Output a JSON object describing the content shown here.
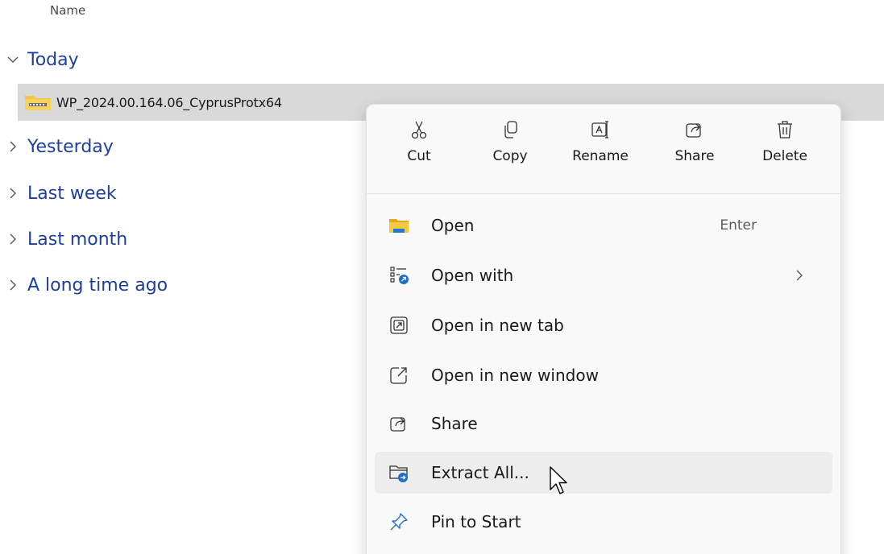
{
  "column_header": "Name",
  "groups": {
    "today": "Today",
    "yesterday": "Yesterday",
    "last_week": "Last week",
    "last_month": "Last month",
    "long_ago": "A long time ago"
  },
  "file": {
    "name": "WP_2024.00.164.06_CyprusProtx64",
    "icon": "zip-folder-icon"
  },
  "context_menu": {
    "quick_actions": {
      "cut": "Cut",
      "copy": "Copy",
      "rename": "Rename",
      "share": "Share",
      "delete": "Delete"
    },
    "items": [
      {
        "label": "Open",
        "shortcut": "Enter",
        "icon": "folder-icon"
      },
      {
        "label": "Open with",
        "icon": "open-with-icon"
      },
      {
        "label": "Open in new tab",
        "icon": "new-tab-icon"
      },
      {
        "label": "Open in new window",
        "icon": "new-window-icon"
      },
      {
        "label": "Share",
        "icon": "share-icon"
      },
      {
        "label": "Extract All...",
        "icon": "extract-icon"
      },
      {
        "label": "Pin to Start",
        "icon": "pin-icon"
      }
    ]
  },
  "colors": {
    "group_text": "#1e3f9e",
    "selection": "#d9d9d9",
    "menu_bg": "#f9f9f9",
    "hover": "#ededed"
  }
}
